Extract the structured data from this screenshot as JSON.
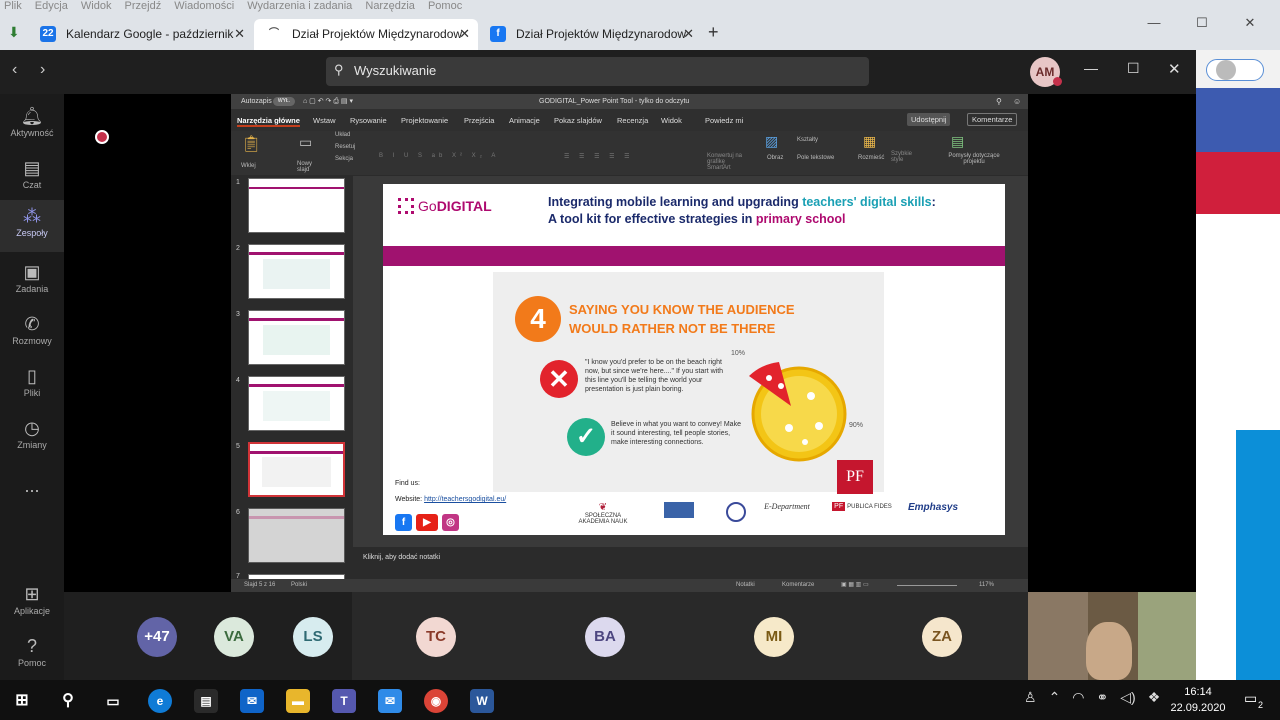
{
  "browser": {
    "menu": [
      "Plik",
      "Edycja",
      "Widok",
      "Przejdź",
      "Wiadomości",
      "Wydarzenia i zadania",
      "Narzędzia",
      "Pomoc"
    ],
    "tabs": [
      {
        "label": "Kalendarz Google - październik",
        "icon_text": "22"
      },
      {
        "label": "Dział Projektów Międzynarodow",
        "icon_text": ""
      },
      {
        "label": "Dział Projektów Międzynarodow",
        "icon_text": "f"
      }
    ],
    "new_tab": "+"
  },
  "teams": {
    "search_placeholder": "Wyszukiwanie",
    "user_initials": "AM",
    "rail": [
      {
        "label": "Aktywność",
        "icon": "bell-icon"
      },
      {
        "label": "Czat",
        "icon": "chat-icon"
      },
      {
        "label": "Zespoły",
        "icon": "teams-icon"
      },
      {
        "label": "Zadania",
        "icon": "tasks-icon"
      },
      {
        "label": "Rozmowy",
        "icon": "phone-icon"
      },
      {
        "label": "Pliki",
        "icon": "files-icon"
      },
      {
        "label": "Zmiany",
        "icon": "shifts-icon"
      },
      {
        "label": "...",
        "icon": "more-icon"
      }
    ],
    "rail_bottom": [
      {
        "label": "Aplikacje",
        "icon": "apps-icon"
      },
      {
        "label": "Pomoc",
        "icon": "help-icon"
      }
    ],
    "participants": [
      {
        "initials": "+47",
        "bg": "#6264a7",
        "fg": "#ffffff"
      },
      {
        "initials": "VA",
        "bg": "#dbe9dc",
        "fg": "#3b6b3e"
      },
      {
        "initials": "LS",
        "bg": "#d7ecef",
        "fg": "#2f6a73"
      },
      {
        "initials": "TC",
        "bg": "#f2d8d2",
        "fg": "#8a3a2a"
      },
      {
        "initials": "BA",
        "bg": "#dcd9ee",
        "fg": "#4d4680"
      },
      {
        "initials": "MI",
        "bg": "#f6e9c9",
        "fg": "#7a5a14"
      },
      {
        "initials": "ZA",
        "bg": "#f5e6cc",
        "fg": "#7a5520"
      }
    ]
  },
  "ppt": {
    "autosave": "Autozapis",
    "autosave_state": "WYŁ.",
    "title": "GODIGITAL_Power Point Tool - tylko do odczytu",
    "tabs": [
      "Narzędzia główne",
      "Wstaw",
      "Rysowanie",
      "Projektowanie",
      "Przejścia",
      "Animacje",
      "Pokaz slajdów",
      "Recenzja",
      "Widok",
      "Powiedz mi"
    ],
    "share": "Udostępnij",
    "comments": "Komentarze",
    "ribbon": {
      "paste": "Wklej",
      "new_slide": "Nowy slajd",
      "layout": "Układ",
      "reset": "Resetuj",
      "section": "Sekcja",
      "convert": "Konwertuj na grafikę SmartArt",
      "picture": "Obraz",
      "shapes": "Kształty",
      "textbox": "Pole tekstowe",
      "arrange": "Rozmieść",
      "quick_styles": "Szybkie style",
      "add_ins": "Pomysły dotyczące projektu"
    },
    "slide_numbers": [
      "1",
      "2",
      "3",
      "4",
      "5",
      "6",
      "7"
    ],
    "notes_placeholder": "Kliknij, aby dodać notatki",
    "status": {
      "slide": "Slajd 5 z 16",
      "language": "Polski",
      "notes": "Notatki",
      "comments": "Komentarze",
      "zoom": "117%"
    }
  },
  "slide": {
    "logo_go": "Go",
    "logo_digital": "DIGITAL",
    "title_part1": "Integrating mobile learning and upgrading ",
    "title_hl1": "teachers' digital skills",
    "title_part2": ":",
    "title_line2a": "A tool kit for effective strategies in ",
    "title_hl2": "primary school",
    "badge_number": "4",
    "heading": "SAYING YOU KNOW THE AUDIENCE WOULD RATHER NOT BE THERE",
    "quote": "\"I know you'd prefer to be on the beach right now, but since we're here....\" If you start with this line you'll be telling the world your presentation is just plain boring.",
    "advice": "Believe in what you want to convey! Make it sound interesting, tell people stories, make interesting connections.",
    "label_10": "10%",
    "label_90": "90%",
    "pf": "PF",
    "find_us": "Find us:",
    "website_label": "Website:",
    "website_url": "http://teachersgodigital.eu/",
    "partners": [
      "SPOŁECZNA AKADEMIA NAUK",
      "",
      "",
      "E-Department",
      "PUBLICA FIDES",
      "Emphasys"
    ]
  },
  "taskbar": {
    "time": "16:14",
    "date": "22.09.2020",
    "notifications": "2"
  }
}
